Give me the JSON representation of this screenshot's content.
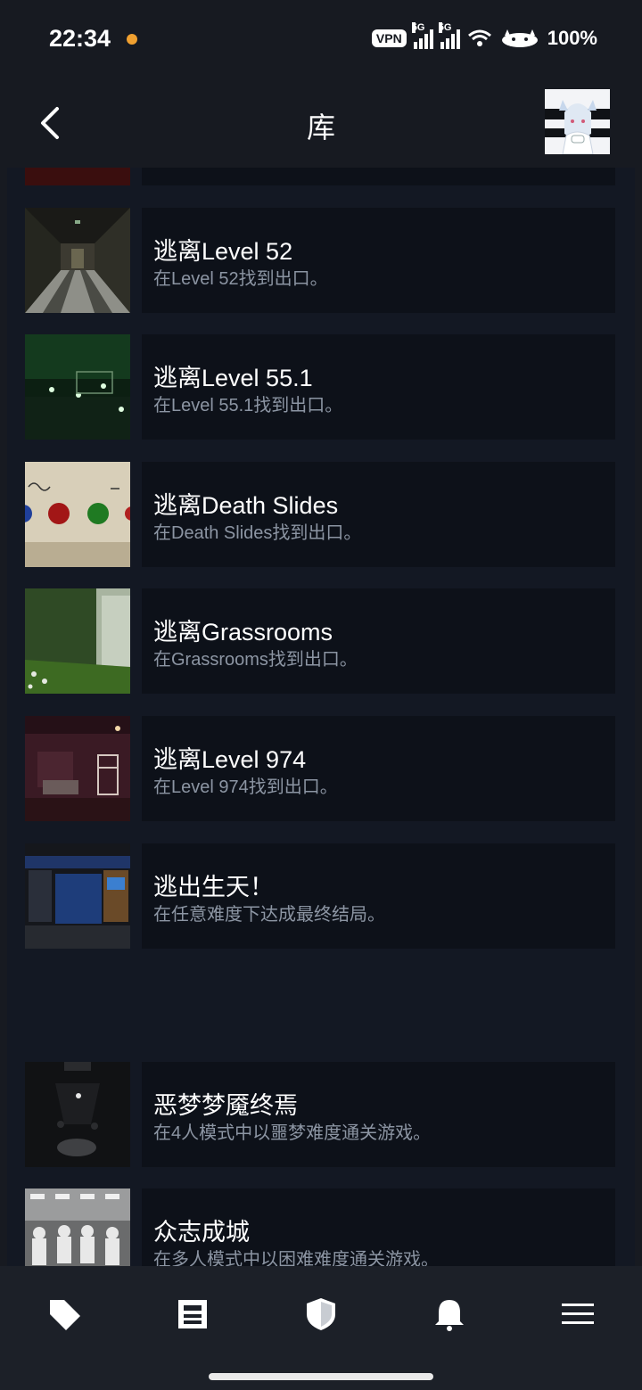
{
  "status": {
    "time": "22:34",
    "vpn": "VPN",
    "net1": "5G",
    "net2": "5G",
    "battery": "100%"
  },
  "header": {
    "title": "库",
    "back_icon": "back-arrow-icon",
    "avatar": "user-avatar"
  },
  "achievements": [
    {
      "name": "",
      "desc": ""
    },
    {
      "name": "逃离Level 52",
      "desc": "在Level 52找到出口。"
    },
    {
      "name": "逃离Level 55.1",
      "desc": "在Level 55.1找到出口。"
    },
    {
      "name": "逃离Death Slides",
      "desc": "在Death Slides找到出口。"
    },
    {
      "name": "逃离Grassrooms",
      "desc": "在Grassrooms找到出口。"
    },
    {
      "name": "逃离Level 974",
      "desc": "在Level 974找到出口。"
    },
    {
      "name": "逃出生天！",
      "desc": "在任意难度下达成最终结局。"
    },
    {
      "name": "恶梦梦魇终焉",
      "desc": "在4人模式中以噩梦难度通关游戏。"
    },
    {
      "name": "众志成城",
      "desc": "在多人模式中以困难难度通关游戏。"
    }
  ],
  "nav": [
    {
      "icon": "tag-icon"
    },
    {
      "icon": "news-icon"
    },
    {
      "icon": "shield-icon"
    },
    {
      "icon": "bell-icon"
    },
    {
      "icon": "menu-icon"
    }
  ],
  "colors": {
    "background": "#171a21",
    "card": "#0d1119",
    "secondary_text": "#8c95a3"
  }
}
